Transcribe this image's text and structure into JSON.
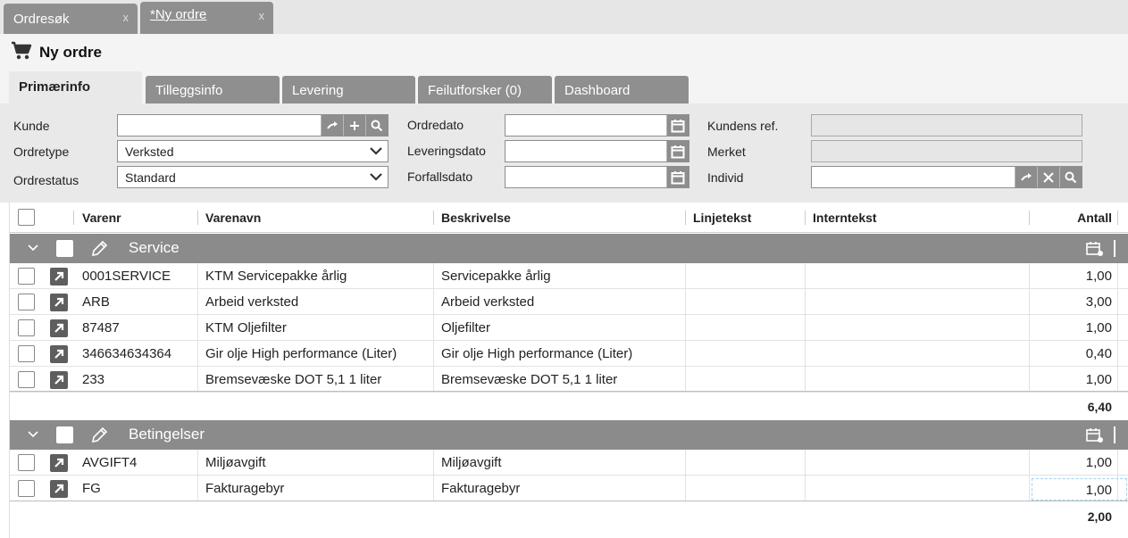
{
  "doc_tabs": [
    {
      "label": "Ordresøk",
      "close": "x"
    },
    {
      "label": "*Ny ordre",
      "close": "x"
    }
  ],
  "header": {
    "title": "Ny ordre"
  },
  "section_tabs": [
    "Primærinfo",
    "Tilleggsinfo",
    "Levering",
    "Feilutforsker (0)",
    "Dashboard"
  ],
  "form": {
    "kunde_label": "Kunde",
    "kunde_value": "",
    "ordretype_label": "Ordretype",
    "ordretype_value": "Verksted",
    "ordrestatus_label": "Ordrestatus",
    "ordrestatus_value": "Standard",
    "ordredato_label": "Ordredato",
    "ordredato_value": "",
    "leveringsdato_label": "Leveringsdato",
    "leveringsdato_value": "",
    "forfallsdato_label": "Forfallsdato",
    "forfallsdato_value": "",
    "kundens_ref_label": "Kundens ref.",
    "kundens_ref_value": "",
    "merket_label": "Merket",
    "merket_value": "",
    "individ_label": "Individ",
    "individ_value": ""
  },
  "grid": {
    "columns": [
      "Varenr",
      "Varenavn",
      "Beskrivelse",
      "Linjetekst",
      "Interntekst",
      "Antall"
    ],
    "groups": [
      {
        "name": "Service",
        "rows": [
          {
            "varenr": "0001SERVICE",
            "varenavn": "KTM Servicepakke årlig",
            "beskrivelse": "Servicepakke årlig",
            "linjetekst": "",
            "interntekst": "",
            "antall": "1,00"
          },
          {
            "varenr": "ARB",
            "varenavn": "Arbeid verksted",
            "beskrivelse": "Arbeid verksted",
            "linjetekst": "",
            "interntekst": "",
            "antall": "3,00"
          },
          {
            "varenr": "87487",
            "varenavn": "KTM Oljefilter",
            "beskrivelse": "Oljefilter",
            "linjetekst": "",
            "interntekst": "",
            "antall": "1,00"
          },
          {
            "varenr": "346634634364",
            "varenavn": "Gir olje High performance (Liter)",
            "beskrivelse": "Gir olje High performance (Liter)",
            "linjetekst": "",
            "interntekst": "",
            "antall": "0,40"
          },
          {
            "varenr": "233",
            "varenavn": "Bremsevæske DOT 5,1 1 liter",
            "beskrivelse": "Bremsevæske DOT 5,1 1 liter",
            "linjetekst": "",
            "interntekst": "",
            "antall": "1,00"
          }
        ],
        "sum": "6,40"
      },
      {
        "name": "Betingelser",
        "rows": [
          {
            "varenr": "AVGIFT4",
            "varenavn": "Miljøavgift",
            "beskrivelse": "Miljøavgift",
            "linjetekst": "",
            "interntekst": "",
            "antall": "1,00"
          },
          {
            "varenr": "FG",
            "varenavn": "Fakturagebyr",
            "beskrivelse": "Fakturagebyr",
            "linjetekst": "",
            "interntekst": "",
            "antall": "1,00"
          }
        ],
        "sum": "2,00"
      }
    ]
  },
  "icons": {
    "cart": "cart-icon",
    "goto": "arrow-right-icon",
    "add": "plus-icon",
    "search": "search-icon",
    "clear": "close-icon",
    "calendar": "calendar-icon",
    "dropdown": "chevron-down-icon",
    "collapse": "chevron-down-icon",
    "edit": "pencil-icon",
    "row_link": "arrow-up-right-icon"
  },
  "colors": {
    "tab_gray": "#8f8f8f",
    "group_gray": "#8b8b8b",
    "form_bg": "#e9e9e9"
  }
}
